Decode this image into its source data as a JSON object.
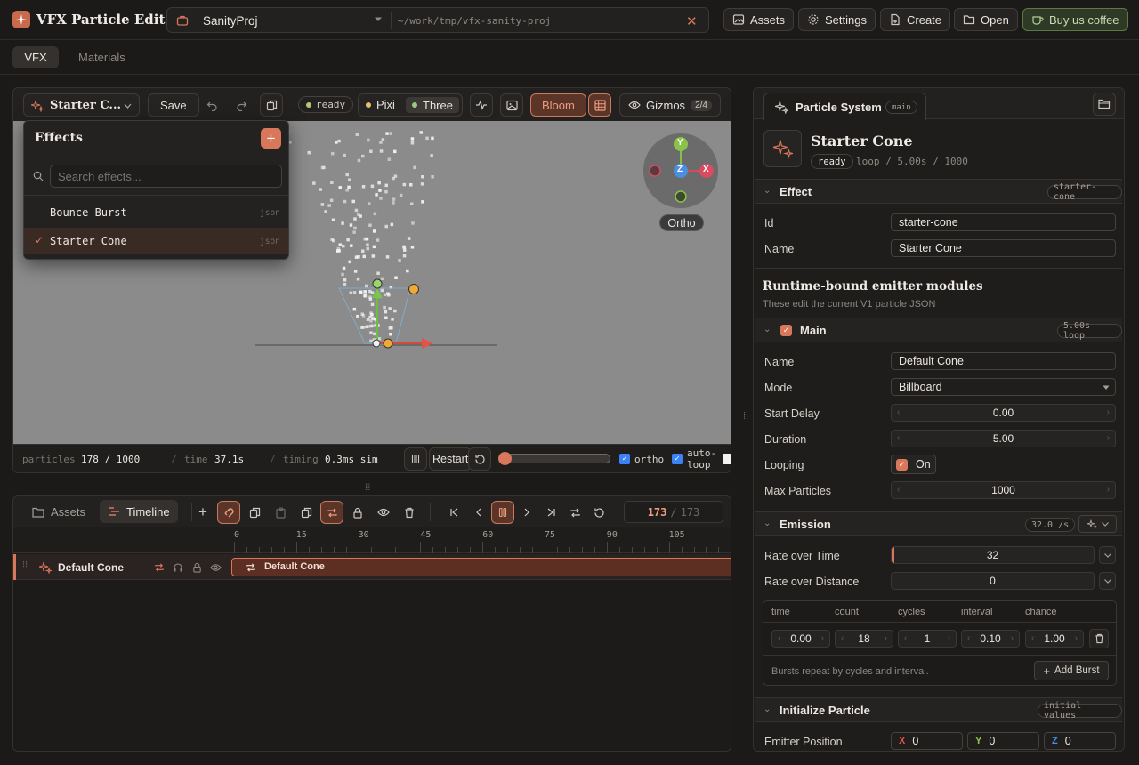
{
  "app": {
    "title": "VFX Particle Editor"
  },
  "project": {
    "name": "SanityProj",
    "path": "~/work/tmp/vfx-sanity-proj"
  },
  "topbar": {
    "assets": "Assets",
    "settings": "Settings",
    "create": "Create",
    "open": "Open",
    "coffee": "Buy us coffee"
  },
  "tabs": [
    {
      "label": "VFX"
    },
    {
      "label": "Materials"
    }
  ],
  "toolbar": {
    "effect": "Starter C...",
    "save": "Save",
    "status": "ready",
    "pixi": "Pixi",
    "three": "Three",
    "bloom": "Bloom",
    "gizmos": "Gizmos",
    "gizmos_count": "2/4"
  },
  "effects_menu": {
    "title": "Effects",
    "search_placeholder": "Search effects...",
    "items": [
      {
        "name": "Bounce Burst",
        "type": "json"
      },
      {
        "name": "Starter Cone",
        "type": "json",
        "check": "✓"
      }
    ]
  },
  "gizmo": {
    "y": "Y",
    "z": "Z",
    "x": "X",
    "ortho": "Ortho"
  },
  "status": {
    "particles_label": "particles",
    "particles": "178 / 1000",
    "time_label": "time",
    "time": "37.1s",
    "timing_label": "timing",
    "timing": "0.3ms sim",
    "restart": "Restart",
    "ortho": "ortho",
    "autoloop": "auto-loop",
    "scrub_fraction": 0.0
  },
  "timeline": {
    "assets_tab": "Assets",
    "timeline_tab": "Timeline",
    "frame": "173",
    "frame_total": "173",
    "ticks": [
      "0",
      "15",
      "30",
      "45",
      "60",
      "75",
      "90",
      "105"
    ],
    "track": {
      "name": "Default Cone",
      "clip": "Default Cone"
    }
  },
  "panel": {
    "tab": "Particle System",
    "tab_badge": "main",
    "name": "Starter Cone",
    "status": "ready",
    "meta": "loop / 5.00s / 1000",
    "effect": {
      "title": "Effect",
      "badge": "starter-cone",
      "id_label": "Id",
      "id": "starter-cone",
      "name_label": "Name",
      "name": "Starter Cone"
    },
    "modules": {
      "title": "Runtime-bound emitter modules",
      "subtitle": "These edit the current V1 particle JSON"
    },
    "main": {
      "title": "Main",
      "badge": "5.00s loop",
      "name_label": "Name",
      "name": "Default Cone",
      "mode_label": "Mode",
      "mode": "Billboard",
      "delay_label": "Start Delay",
      "delay": "0.00",
      "duration_label": "Duration",
      "duration": "5.00",
      "looping_label": "Looping",
      "looping": "On",
      "max_label": "Max Particles",
      "max": "1000"
    },
    "emission": {
      "title": "Emission",
      "badge": "32.0 /s",
      "rate_time_label": "Rate over Time",
      "rate_time": "32",
      "rate_dist_label": "Rate over Distance",
      "rate_dist": "0",
      "burst_headers": [
        "time",
        "count",
        "cycles",
        "interval",
        "chance"
      ],
      "burst_values": [
        "0.00",
        "18",
        "1",
        "0.10",
        "1.00"
      ],
      "burst_note": "Bursts repeat by cycles and interval.",
      "add_burst": "Add Burst"
    },
    "init": {
      "title": "Initialize Particle",
      "badge": "initial values",
      "pos_label": "Emitter Position",
      "x_label": "X",
      "x": "0",
      "y_label": "Y",
      "y": "0",
      "z_label": "Z",
      "z": "0"
    }
  },
  "colors": {
    "accent": "#d9775a",
    "bg": "#1b1a19",
    "viewport": "#8a8a8a"
  }
}
